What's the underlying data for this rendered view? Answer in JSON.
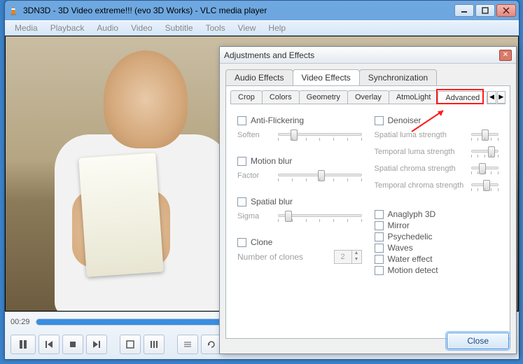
{
  "window": {
    "title": "3DN3D - 3D Video extreme!!! (evo 3D Works) - VLC media player"
  },
  "menu": {
    "media": "Media",
    "playback": "Playback",
    "audio": "Audio",
    "video": "Video",
    "subtitle": "Subtitle",
    "tools": "Tools",
    "view": "View",
    "help": "Help"
  },
  "player": {
    "time": "00:29"
  },
  "dialog": {
    "title": "Adjustments and Effects",
    "tabs": {
      "audio": "Audio Effects",
      "video": "Video Effects",
      "sync": "Synchronization"
    },
    "subtabs": {
      "crop": "Crop",
      "colors": "Colors",
      "geometry": "Geometry",
      "overlay": "Overlay",
      "atmolight": "AtmoLight",
      "advanced": "Advanced"
    },
    "advanced": {
      "antiflicker": "Anti-Flickering",
      "soften": "Soften",
      "motionblur": "Motion blur",
      "factor": "Factor",
      "spatialblur": "Spatial blur",
      "sigma": "Sigma",
      "clone": "Clone",
      "clone_count_label": "Number of clones",
      "clone_count": "2",
      "denoiser": "Denoiser",
      "spatial_luma": "Spatial luma strength",
      "temporal_luma": "Temporal luma strength",
      "spatial_chroma": "Spatial chroma strength",
      "temporal_chroma": "Temporal chroma strength",
      "anaglyph": "Anaglyph 3D",
      "mirror": "Mirror",
      "psychedelic": "Psychedelic",
      "waves": "Waves",
      "water": "Water effect",
      "motion_detect": "Motion detect"
    },
    "close": "Close"
  }
}
